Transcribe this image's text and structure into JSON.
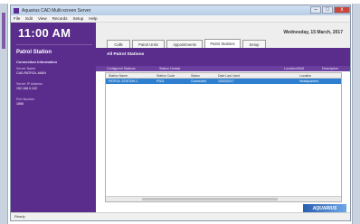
{
  "window": {
    "title": "Aquarius CAD Multi-screen Server",
    "controls": {
      "minimize": "–",
      "maximize": "□",
      "close": "x"
    }
  },
  "menu": [
    "File",
    "Edit",
    "View",
    "Records",
    "Setup",
    "Help"
  ],
  "sidebar": {
    "clock": "11:00 AM",
    "title": "Patrol Station",
    "section": "Connection Information",
    "fields": [
      {
        "label": "Server Name",
        "value": "CAD-PATROL-MAIN"
      },
      {
        "label": "Server IP Address",
        "value": "192.168.0.102"
      },
      {
        "label": "Port Number",
        "value": "1856"
      }
    ]
  },
  "header": {
    "date": "Wednesday, 15 March, 2017",
    "tabs": [
      "Calls",
      "Patrol Units",
      "Appointments",
      "Patrol Stations",
      "Setup"
    ],
    "active_tab": 3
  },
  "panel": {
    "title": "All Patrol Stations",
    "subheaders": [
      "Configured Stations",
      "Station Details",
      "Location/Shift",
      "Description"
    ],
    "columns": [
      "Station Name",
      "Station Code",
      "Status",
      "Date Last Used",
      "Location"
    ],
    "rows": [
      [
        "PATROL STATION 1",
        "PS01",
        "Connected",
        "15/03/2017",
        "Headquarters"
      ]
    ]
  },
  "brand": {
    "logo_text": "AQUARIUS"
  },
  "status": {
    "text": "Ready"
  }
}
